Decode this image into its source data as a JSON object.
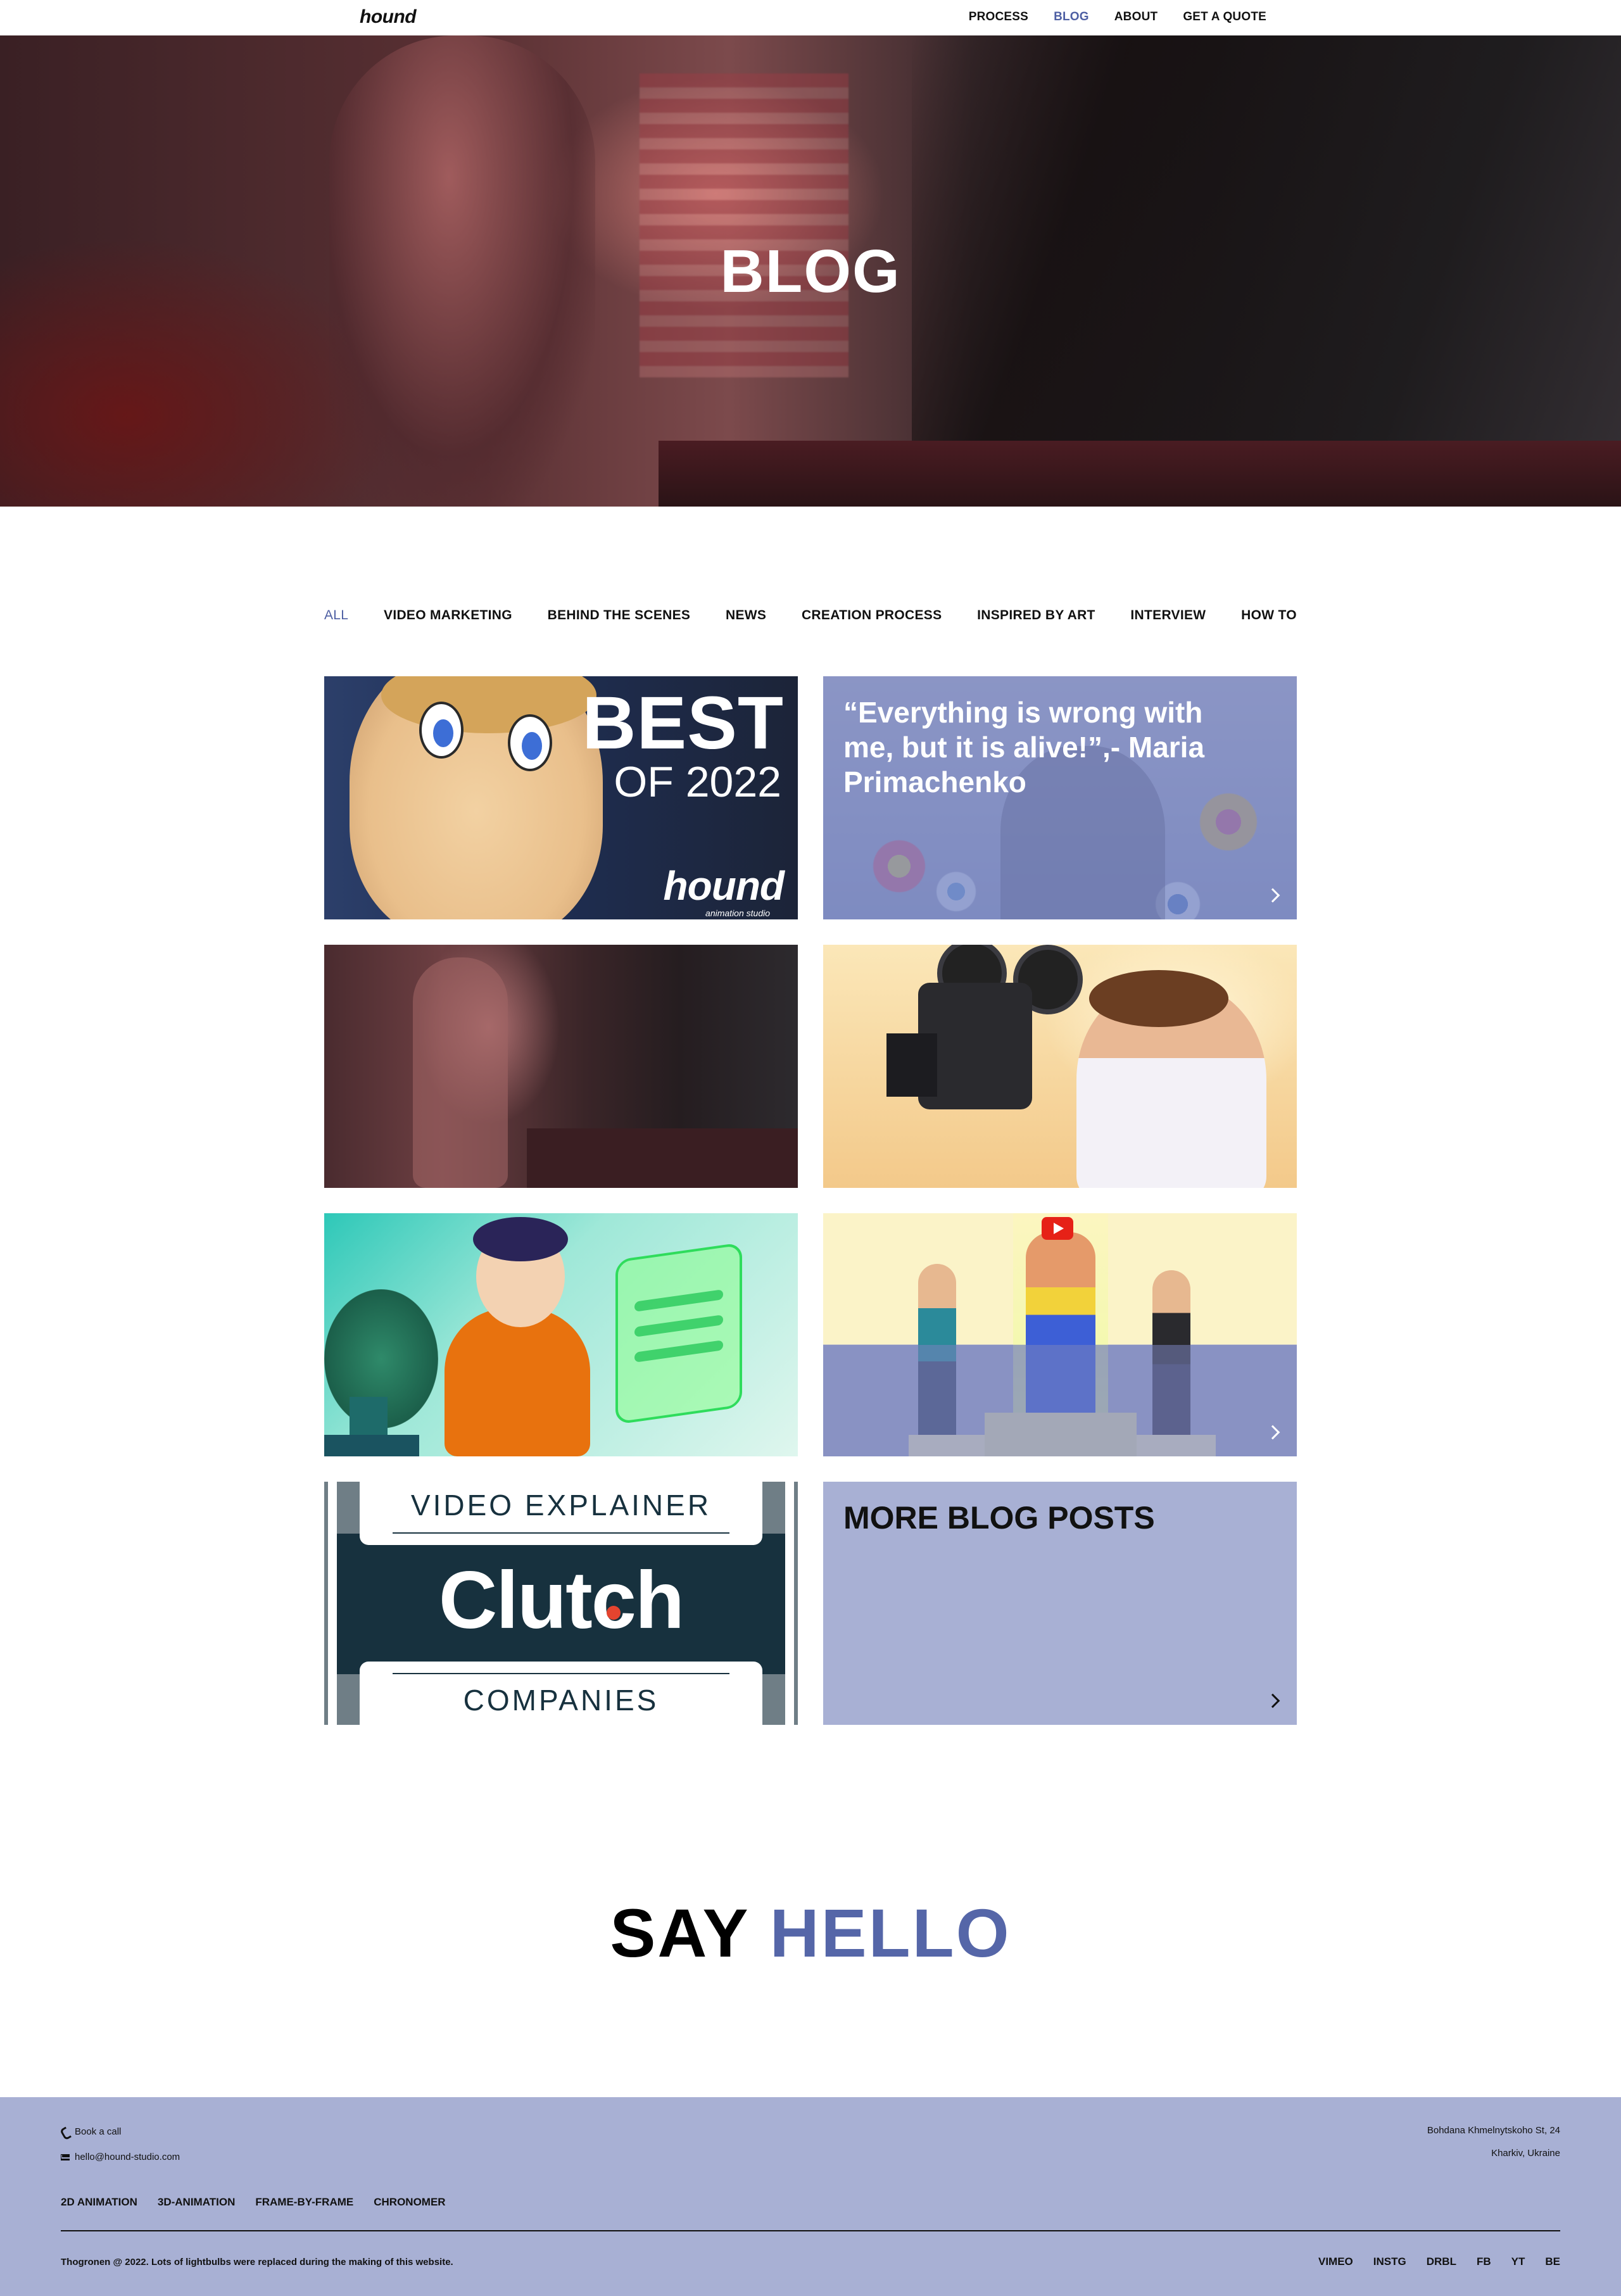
{
  "header": {
    "logo": "hound",
    "nav": [
      {
        "label": "PROCESS",
        "active": false
      },
      {
        "label": "BLOG",
        "active": true
      },
      {
        "label": "ABOUT",
        "active": false
      },
      {
        "label": "GET A QUOTE",
        "active": false
      }
    ]
  },
  "hero": {
    "title": "BLOG"
  },
  "tabs": [
    {
      "label": "ALL",
      "active": true
    },
    {
      "label": "VIDEO MARKETING",
      "active": false
    },
    {
      "label": "BEHIND THE SCENES",
      "active": false
    },
    {
      "label": "NEWS",
      "active": false
    },
    {
      "label": "CREATION PROCESS",
      "active": false
    },
    {
      "label": "INSPIRED BY ART",
      "active": false
    },
    {
      "label": "INTERVIEW",
      "active": false
    },
    {
      "label": "HOW TO",
      "active": false
    }
  ],
  "posts": {
    "best": {
      "headline": "BEST",
      "year": "OF 2022",
      "watermark": "hound",
      "watermark_sub": "animation studio"
    },
    "quote": {
      "text": "“Everything is wrong with me, but it is alive!”,- Maria Primachenko"
    },
    "clutch": {
      "top": "VIDEO EXPLAINER",
      "brand": "Clutch",
      "bottom": "COMPANIES"
    },
    "more": {
      "title": "MORE BLOG POSTS"
    }
  },
  "hello": {
    "word1": "SAY",
    "word2": "HELLO"
  },
  "footer": {
    "call": "Book a call",
    "email": "hello@hound-studio.com",
    "address_line1": "Bohdana Khmelnytskoho St, 24",
    "address_line2": "Kharkiv, Ukraine",
    "services": [
      "2D ANIMATION",
      "3D-ANIMATION",
      "FRAME-BY-FRAME",
      "CHRONOMER"
    ],
    "copyright": "Thogronen @ 2022. Lots of lightbulbs were replaced during the making of this website.",
    "social": [
      "VIMEO",
      "INSTG",
      "DRBL",
      "FB",
      "YT",
      "BE"
    ]
  },
  "colors": {
    "accent": "#4e5fa3",
    "footer_bg": "#a8b0d4",
    "hello_accent": "#5566a8"
  }
}
